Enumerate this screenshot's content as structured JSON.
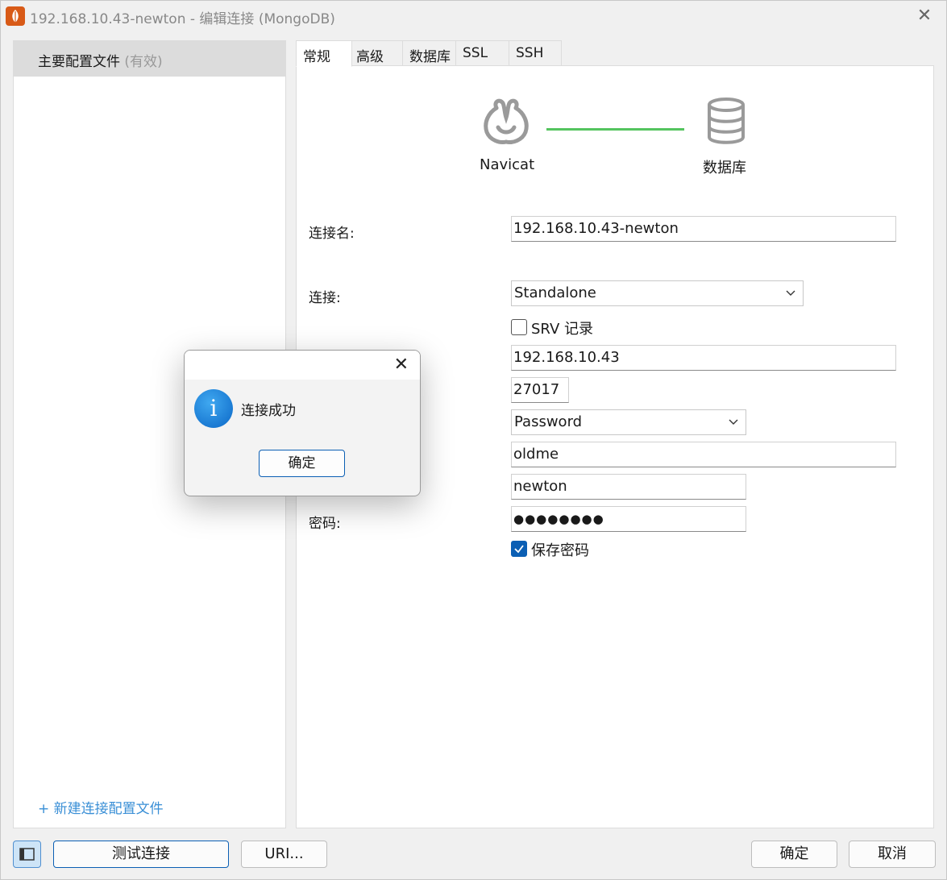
{
  "window": {
    "title": "192.168.10.43-newton - 编辑连接 (MongoDB)",
    "close_glyph": "✕"
  },
  "sidebar": {
    "profile_name": "主要配置文件",
    "profile_status": "(有效)",
    "new_profile_label": "+ 新建连接配置文件"
  },
  "tabs": [
    {
      "label": "常规",
      "active": true
    },
    {
      "label": "高级"
    },
    {
      "label": "数据库"
    },
    {
      "label": "SSL"
    },
    {
      "label": "SSH"
    }
  ],
  "diagram": {
    "client_label": "Navicat",
    "server_label": "数据库",
    "link_color": "#54c45e"
  },
  "form": {
    "connection_name_label": "连接名:",
    "connection_name_value": "192.168.10.43-newton",
    "connection_label": "连接:",
    "connection_type": "Standalone",
    "srv_label": "SRV 记录",
    "host_value": "192.168.10.43",
    "port_value": "27017",
    "auth_value": "Password",
    "auth_db_value": "oldme",
    "username_value": "newton",
    "password_label": "密码:",
    "password_value": "●●●●●●●●",
    "save_password_label": "保存密码"
  },
  "footer": {
    "test_button": "测试连接",
    "uri_button": "URI...",
    "ok_button": "确定",
    "cancel_button": "取消"
  },
  "dialog": {
    "message": "连接成功",
    "ok_button": "确定",
    "close_glyph": "✕",
    "icon_glyph": "i"
  },
  "colors": {
    "accent": "#0b5fb4",
    "link_text": "#3a8fd6",
    "app_icon": "#d85a17"
  }
}
